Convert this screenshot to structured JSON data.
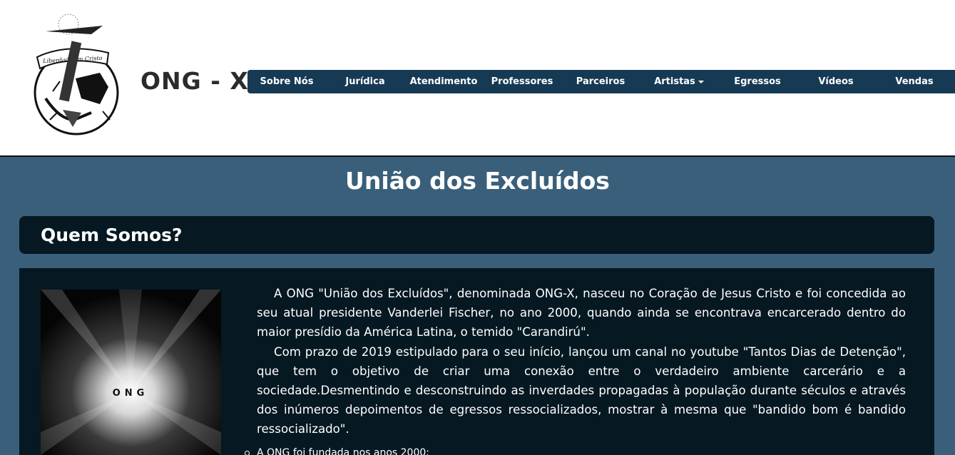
{
  "header": {
    "brand": "ONG - X",
    "logo_text": "Liberdade em Cristo",
    "logo_icon": "shackle-emblem-icon"
  },
  "nav": {
    "items": [
      {
        "label": "Sobre Nós"
      },
      {
        "label": "Jurídica"
      },
      {
        "label": "Atendimento"
      },
      {
        "label": "Professores"
      },
      {
        "label": "Parceiros"
      },
      {
        "label": "Artistas",
        "dropdown": true
      },
      {
        "label": "Egressos"
      },
      {
        "label": "Vídeos"
      },
      {
        "label": "Vendas"
      }
    ]
  },
  "page": {
    "title": "União dos Excluídos"
  },
  "section": {
    "title": "Quem Somos?",
    "image_text": "ONG",
    "paragraphs": [
      "A ONG \"União dos Excluídos\", denominada ONG-X, nasceu no Coração de Jesus Cristo e foi concedida ao seu atual presidente Vanderlei Fischer, no ano 2000, quando ainda se encontrava encarcerado dentro do maior presídio da América Latina, o temido \"Carandirú\".",
      "Com prazo de 2019 estipulado para o seu início, lançou um canal no youtube \"Tantos Dias de Detenção\", que tem o objetivo de criar uma conexão entre o verdadeiro ambiente carcerário e a sociedade.Desmentindo e desconstruindo as inverdades propagadas à população durante séculos e através dos inúmeros depoimentos de egressos ressocializados, mostrar à mesma que \"bandido bom é bandido ressocializado\"."
    ],
    "list": [
      "A ONG foi fundada nos anos 2000;"
    ]
  },
  "colors": {
    "page_bg": "#3a5f7a",
    "nav_bg": "#163a54",
    "panel_bg": "#061822",
    "header_bg": "#ffffff"
  }
}
